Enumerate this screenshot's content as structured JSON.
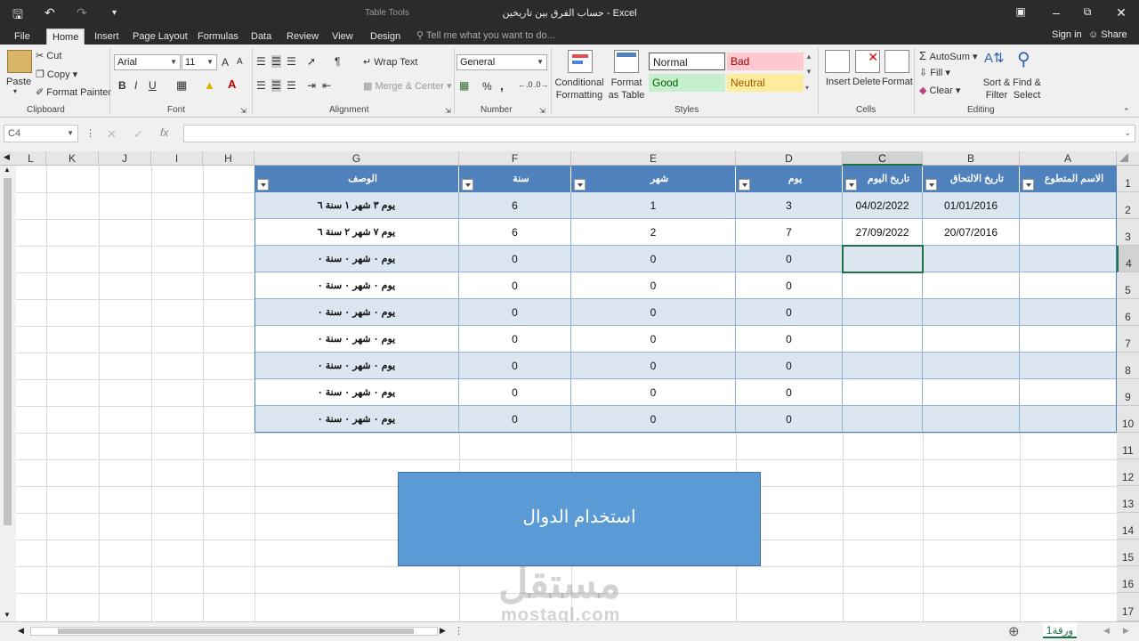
{
  "window": {
    "title": "حساب الفرق بين تاريخين - Excel",
    "context_tab_group": "Table Tools"
  },
  "tabs": [
    "File",
    "Home",
    "Insert",
    "Page Layout",
    "Formulas",
    "Data",
    "Review",
    "View",
    "Design"
  ],
  "active_tab": "Home",
  "tell_me": "Tell me what you want to do...",
  "account": {
    "signin": "Sign in",
    "share": "Share"
  },
  "ribbon": {
    "clipboard": {
      "paste": "Paste",
      "cut": "Cut",
      "copy": "Copy",
      "format_painter": "Format Painter",
      "label": "Clipboard"
    },
    "font": {
      "name": "Arial",
      "size": "11",
      "bold": "B",
      "italic": "I",
      "underline": "U",
      "grow": "A",
      "shrink": "A",
      "label": "Font"
    },
    "alignment": {
      "wrap_text": "Wrap Text",
      "merge_center": "Merge & Center",
      "label": "Alignment"
    },
    "number": {
      "format": "General",
      "percent": "%",
      "comma": ",",
      "label": "Number"
    },
    "styles": {
      "conditional_formatting": "Conditional Formatting",
      "format_as_table": "Format as Table",
      "normal": "Normal",
      "bad": "Bad",
      "good": "Good",
      "neutral": "Neutral",
      "label": "Styles"
    },
    "cells": {
      "insert": "Insert",
      "delete": "Delete",
      "format": "Format",
      "label": "Cells"
    },
    "editing": {
      "autosum": "AutoSum",
      "fill": "Fill",
      "clear": "Clear",
      "sort_filter": "Sort & Filter",
      "find_select": "Find & Select",
      "label": "Editing"
    }
  },
  "formula_bar": {
    "name_box": "C4",
    "fx": "fx",
    "value": ""
  },
  "columns": [
    "L",
    "K",
    "J",
    "I",
    "H",
    "G",
    "F",
    "E",
    "D",
    "C",
    "B",
    "A"
  ],
  "selected_column": "C",
  "rows": [
    "1",
    "2",
    "3",
    "4",
    "5",
    "6",
    "7",
    "8",
    "9",
    "10",
    "11",
    "12",
    "13",
    "14",
    "15",
    "16",
    "17"
  ],
  "selected_row": "4",
  "table": {
    "headers": {
      "A": "الاسم المتطوع",
      "B": "تاريخ الالتحاق",
      "C": "تاريخ اليوم",
      "D": "يوم",
      "E": "شهر",
      "F": "سنة",
      "G": "الوصف"
    },
    "rows": [
      {
        "A": "",
        "B": "01/01/2016",
        "C": "04/02/2022",
        "D": "3",
        "E": "1",
        "F": "6",
        "G": "يوم ٣ شهر ١ سنة ٦"
      },
      {
        "A": "",
        "B": "20/07/2016",
        "C": "27/09/2022",
        "D": "7",
        "E": "2",
        "F": "6",
        "G": "يوم ٧ شهر ٢ سنة ٦"
      },
      {
        "A": "",
        "B": "",
        "C": "",
        "D": "0",
        "E": "0",
        "F": "0",
        "G": "يوم ٠ شهر ٠ سنة ٠"
      },
      {
        "A": "",
        "B": "",
        "C": "",
        "D": "0",
        "E": "0",
        "F": "0",
        "G": "يوم ٠ شهر ٠ سنة ٠"
      },
      {
        "A": "",
        "B": "",
        "C": "",
        "D": "0",
        "E": "0",
        "F": "0",
        "G": "يوم ٠ شهر ٠ سنة ٠"
      },
      {
        "A": "",
        "B": "",
        "C": "",
        "D": "0",
        "E": "0",
        "F": "0",
        "G": "يوم ٠ شهر ٠ سنة ٠"
      },
      {
        "A": "",
        "B": "",
        "C": "",
        "D": "0",
        "E": "0",
        "F": "0",
        "G": "يوم ٠ شهر ٠ سنة ٠"
      },
      {
        "A": "",
        "B": "",
        "C": "",
        "D": "0",
        "E": "0",
        "F": "0",
        "G": "يوم ٠ شهر ٠ سنة ٠"
      },
      {
        "A": "",
        "B": "",
        "C": "",
        "D": "0",
        "E": "0",
        "F": "0",
        "G": "يوم ٠ شهر ٠ سنة ٠"
      }
    ]
  },
  "shape_text": "استخدام الدوال",
  "sheet_tab": "ورقة1",
  "watermark": {
    "arabic": "مستقل",
    "latin": "mostaql.com"
  },
  "colors": {
    "table_header": "#4f81bd",
    "band": "#dce6f1",
    "excel_green": "#217346",
    "shape": "#5b9bd5"
  }
}
